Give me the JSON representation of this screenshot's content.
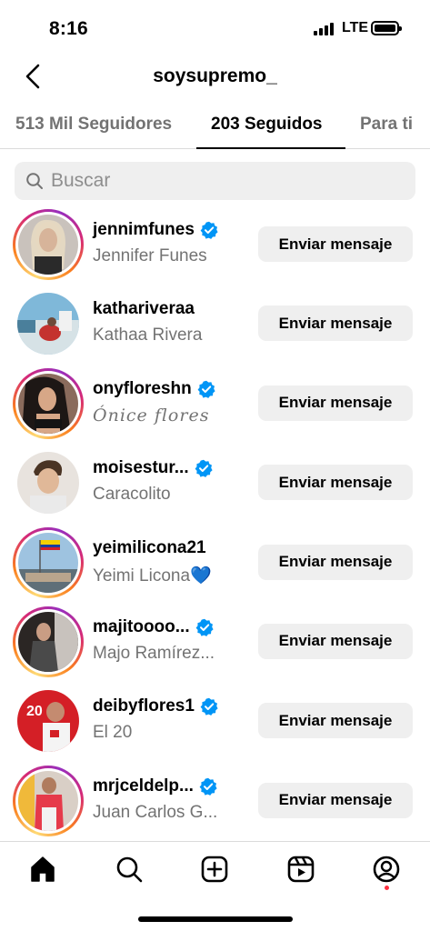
{
  "status": {
    "time": "8:16",
    "network": "LTE"
  },
  "header": {
    "title": "soysupremo_"
  },
  "tabs": [
    {
      "label": "513 Mil Seguidores"
    },
    {
      "label": "203 Seguidos"
    },
    {
      "label": "Para ti"
    }
  ],
  "search": {
    "placeholder": "Buscar"
  },
  "button_label": "Enviar mensaje",
  "users": [
    {
      "username": "jennimfunes",
      "name": "Jennifer Funes",
      "verified": true,
      "story": true
    },
    {
      "username": "kathariveraa",
      "name": "Kathaa Rivera",
      "verified": false,
      "story": false
    },
    {
      "username": "onyfloreshn",
      "name": "Ónice flores",
      "verified": true,
      "story": true
    },
    {
      "username": "moisestur...",
      "name": "Caracolito",
      "verified": true,
      "story": false
    },
    {
      "username": "yeimilicona21",
      "name": "Yeimi Licona💙",
      "verified": false,
      "story": true
    },
    {
      "username": "majitoooo...",
      "name": "Majo Ramírez...",
      "verified": true,
      "story": true
    },
    {
      "username": "deibyflores1",
      "name": "El 20",
      "verified": true,
      "story": false
    },
    {
      "username": "mrjceldelp...",
      "name": "Juan Carlos G...",
      "verified": true,
      "story": true
    }
  ],
  "nav": [
    {
      "icon": "home-icon"
    },
    {
      "icon": "search-icon"
    },
    {
      "icon": "create-icon"
    },
    {
      "icon": "reels-icon"
    },
    {
      "icon": "profile-icon"
    }
  ]
}
